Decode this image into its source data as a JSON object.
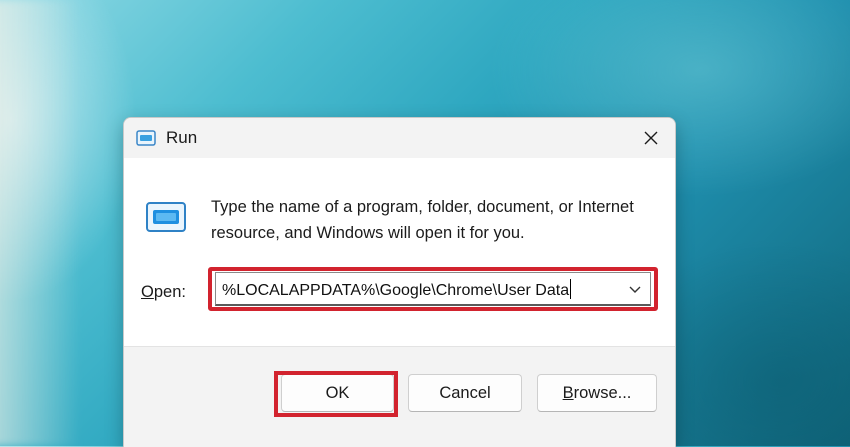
{
  "window": {
    "title": "Run",
    "close_icon": "close-icon",
    "app_icon": "run-window-icon"
  },
  "content": {
    "description": "Type the name of a program, folder, document, or Internet resource, and Windows will open it for you.",
    "open_label_accel": "O",
    "open_label_rest": "pen:",
    "open_value": "%LOCALAPPDATA%\\Google\\Chrome\\User Data",
    "dropdown_icon": "chevron-down-icon"
  },
  "buttons": {
    "ok": "OK",
    "cancel": "Cancel",
    "browse_accel": "B",
    "browse_rest": "rowse..."
  },
  "colors": {
    "highlight": "#d2232e",
    "icon_accent": "#0a74c9"
  }
}
